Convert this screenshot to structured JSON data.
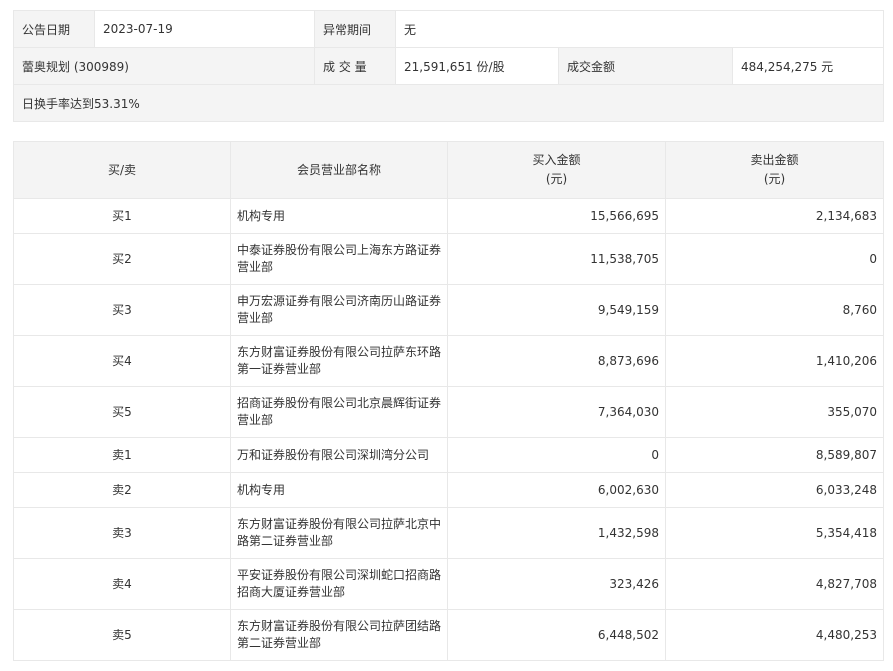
{
  "info": {
    "date_label": "公告日期",
    "date_value": "2023-07-19",
    "period_label": "异常期间",
    "period_value": "无",
    "stock": "蕾奥规划 (300989)",
    "volume_label": "成 交 量",
    "volume_value": "21,591,651 份/股",
    "amount_label": "成交金额",
    "amount_value": "484,254,275 元",
    "reason": "日换手率达到53.31%"
  },
  "table": {
    "headers": {
      "side": "买/卖",
      "dept": "会员营业部名称",
      "buy_line1": "买入金额",
      "buy_line2": "(元)",
      "sell_line1": "卖出金额",
      "sell_line2": "(元)"
    },
    "rows": [
      {
        "side": "买1",
        "name1": "机构专用",
        "name2": "",
        "buy": "15,566,695",
        "sell": "2,134,683"
      },
      {
        "side": "买2",
        "name1": "中泰证券股份有限公司上海东方路证券",
        "name2": "营业部",
        "buy": "11,538,705",
        "sell": "0"
      },
      {
        "side": "买3",
        "name1": "申万宏源证券有限公司济南历山路证券",
        "name2": "营业部",
        "buy": "9,549,159",
        "sell": "8,760"
      },
      {
        "side": "买4",
        "name1": "东方财富证券股份有限公司拉萨东环路",
        "name2": "第一证券营业部",
        "buy": "8,873,696",
        "sell": "1,410,206"
      },
      {
        "side": "买5",
        "name1": "招商证券股份有限公司北京晨辉街证券",
        "name2": "营业部",
        "buy": "7,364,030",
        "sell": "355,070"
      },
      {
        "side": "卖1",
        "name1": "万和证券股份有限公司深圳湾分公司",
        "name2": "",
        "buy": "0",
        "sell": "8,589,807"
      },
      {
        "side": "卖2",
        "name1": "机构专用",
        "name2": "",
        "buy": "6,002,630",
        "sell": "6,033,248"
      },
      {
        "side": "卖3",
        "name1": "东方财富证券股份有限公司拉萨北京中",
        "name2": "路第二证券营业部",
        "buy": "1,432,598",
        "sell": "5,354,418"
      },
      {
        "side": "卖4",
        "name1": "平安证券股份有限公司深圳蛇口招商路",
        "name2": "招商大厦证券营业部",
        "buy": "323,426",
        "sell": "4,827,708"
      },
      {
        "side": "卖5",
        "name1": "东方财富证券股份有限公司拉萨团结路",
        "name2": "第二证券营业部",
        "buy": "6,448,502",
        "sell": "4,480,253"
      }
    ]
  }
}
